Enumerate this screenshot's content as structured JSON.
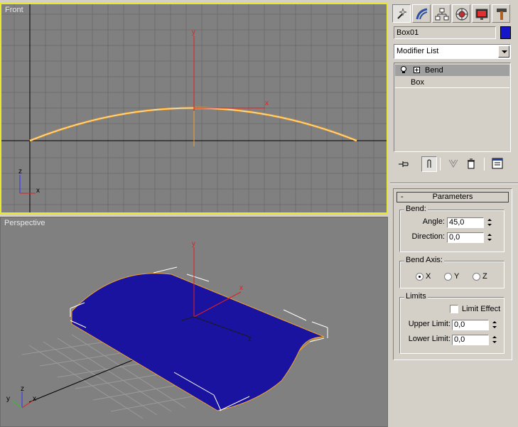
{
  "viewports": {
    "front": {
      "label": "Front",
      "axis_y": "y",
      "axis_x": "x",
      "gizmo_x": "x",
      "gizmo_z": "z"
    },
    "perspective": {
      "label": "Perspective",
      "axis_y": "y",
      "axis_x": "x",
      "axis_z": "z",
      "gizmo_x": "x",
      "gizmo_y": "y",
      "gizmo_z": "z"
    }
  },
  "command_panel": {
    "tabs": [
      "create",
      "modify",
      "hierarchy",
      "motion",
      "display",
      "utilities"
    ],
    "active_tab": "modify",
    "object_name": "Box01",
    "object_color": "#1414c8",
    "modifier_list": "Modifier List",
    "stack": [
      {
        "label": "Bend",
        "selected": true
      },
      {
        "label": "Box",
        "selected": false
      }
    ],
    "rollout": {
      "title": "Parameters",
      "collapse": "-",
      "bend": {
        "group_label": "Bend:",
        "angle_label": "Angle:",
        "angle_value": "45,0",
        "direction_label": "Direction:",
        "direction_value": "0,0"
      },
      "bend_axis": {
        "group_label": "Bend Axis:",
        "options": [
          "X",
          "Y",
          "Z"
        ],
        "selected": "X"
      },
      "limits": {
        "group_label": "Limits",
        "limit_effect_label": "Limit Effect",
        "limit_effect_checked": false,
        "upper_label": "Upper Limit:",
        "upper_value": "0,0",
        "lower_label": "Lower Limit:",
        "lower_value": "0,0"
      }
    }
  },
  "colors": {
    "viewport_bg": "#808080",
    "active_border": "#e8e830",
    "mesh": "#1a13a0",
    "curve": "#f0a030"
  }
}
